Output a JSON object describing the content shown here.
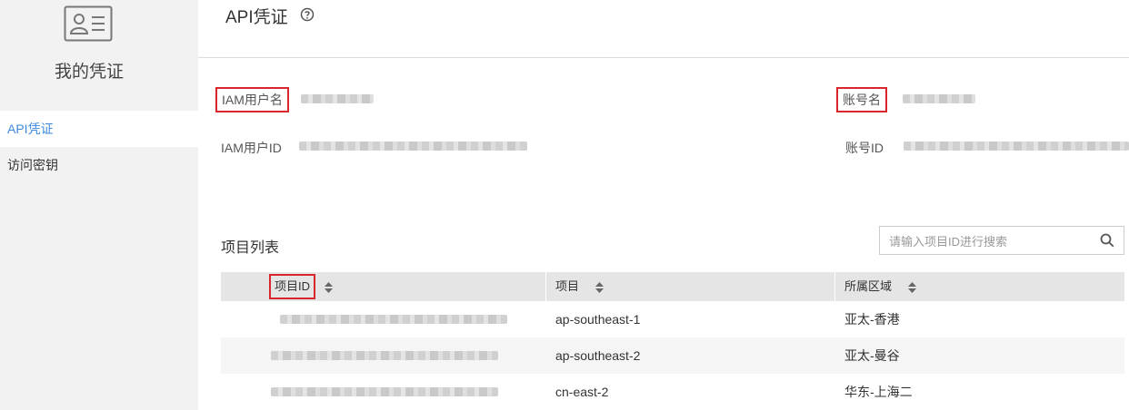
{
  "sidebar": {
    "title": "我的凭证",
    "items": [
      {
        "label": "API凭证",
        "active": true
      },
      {
        "label": "访问密钥",
        "active": false
      }
    ]
  },
  "header": {
    "title": "API凭证",
    "help_icon": "question-circle-icon"
  },
  "info": {
    "iam_user_name_label": "IAM用户名",
    "iam_user_id_label": "IAM用户ID",
    "account_name_label": "账号名",
    "account_id_label": "账号ID",
    "values_redacted": true
  },
  "projects": {
    "title": "项目列表",
    "search_placeholder": "请输入项目ID进行搜索",
    "columns": [
      "项目ID",
      "项目",
      "所属区域"
    ],
    "rows": [
      {
        "project_id": "",
        "project": "ap-southeast-1",
        "region": "亚太-香港"
      },
      {
        "project_id": "",
        "project": "ap-southeast-2",
        "region": "亚太-曼谷"
      },
      {
        "project_id": "",
        "project": "cn-east-2",
        "region": "华东-上海二"
      }
    ]
  },
  "colors": {
    "accent": "#3c8be0",
    "highlight": "#d9262c"
  }
}
